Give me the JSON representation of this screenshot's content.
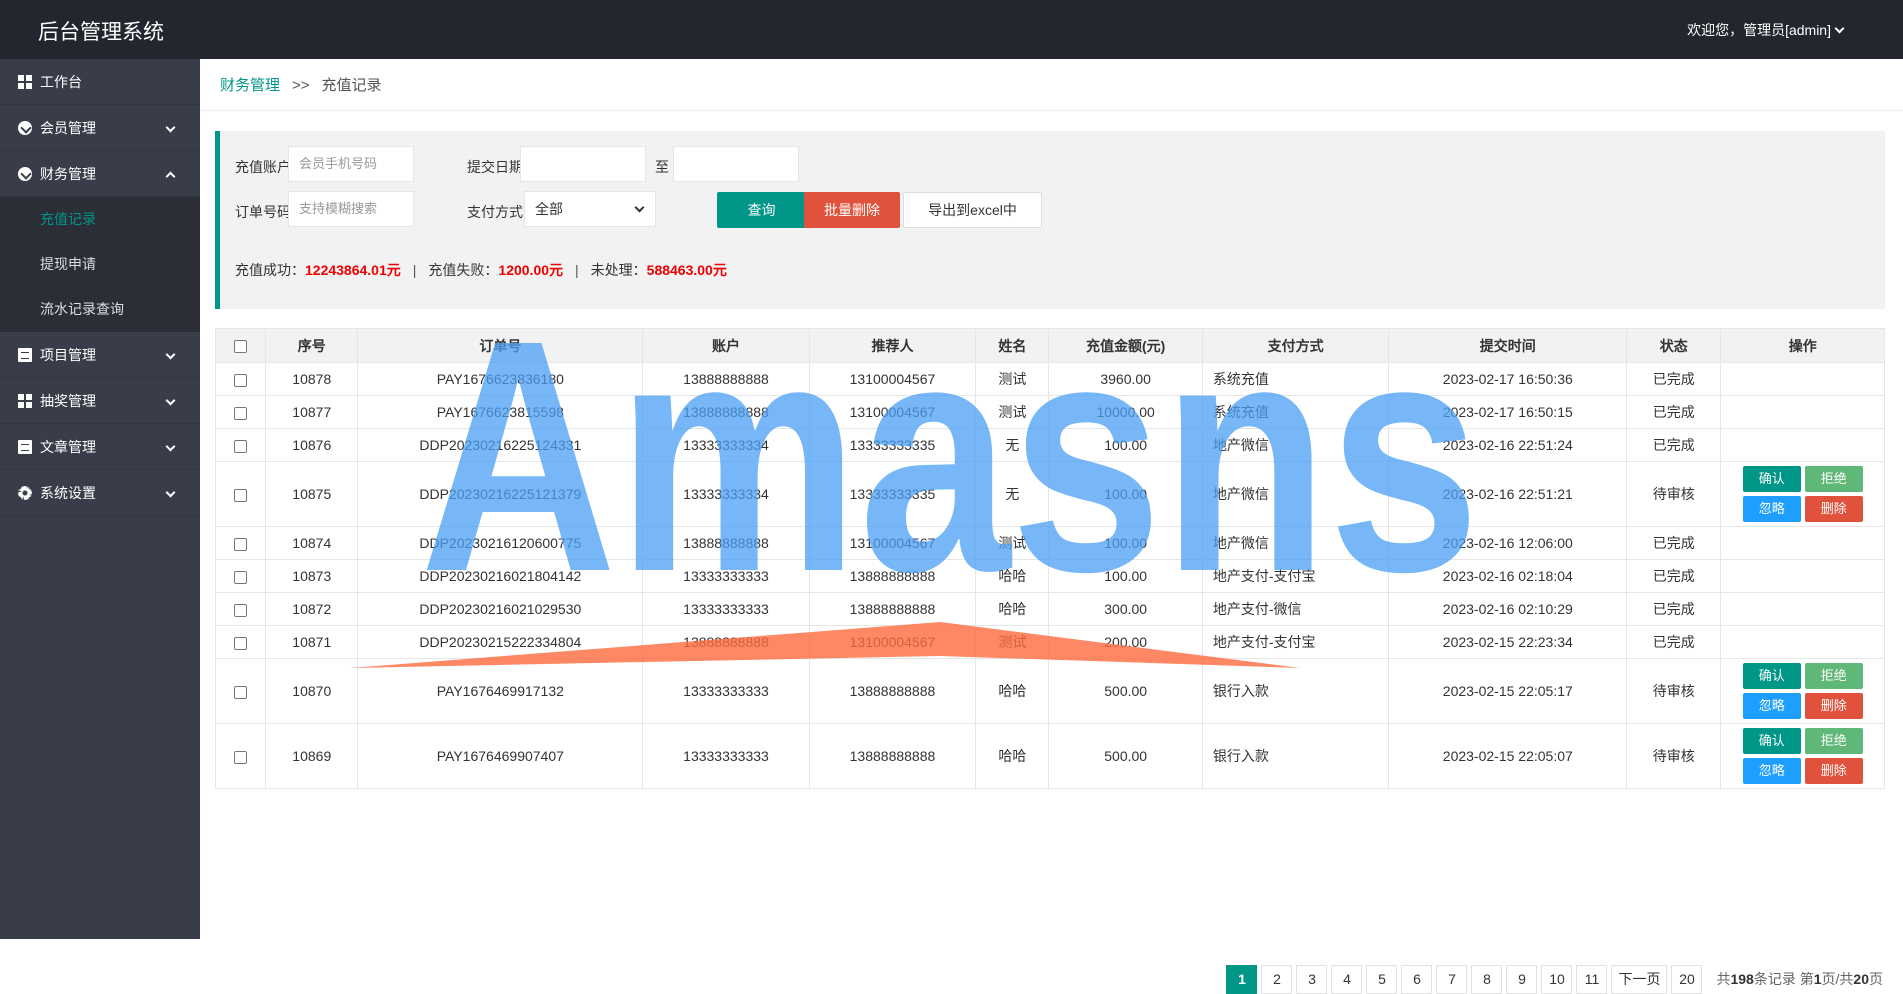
{
  "app": {
    "title": "后台管理系统",
    "user_greeting": "欢迎您，管理员[admin]"
  },
  "sidebar": {
    "items": [
      {
        "label": "工作台",
        "icon": "dashboard-icon"
      },
      {
        "label": "会员管理",
        "icon": "member-icon"
      },
      {
        "label": "财务管理",
        "icon": "finance-icon"
      },
      {
        "label": "项目管理",
        "icon": "project-icon"
      },
      {
        "label": "抽奖管理",
        "icon": "lottery-icon"
      },
      {
        "label": "文章管理",
        "icon": "article-icon"
      },
      {
        "label": "系统设置",
        "icon": "gear-icon"
      }
    ],
    "finance_sub": [
      "充值记录",
      "提现申请",
      "流水记录查询"
    ]
  },
  "breadcrumb": {
    "parent": "财务管理",
    "separator": ">>",
    "current": "充值记录"
  },
  "filter": {
    "account_label": "充值账户",
    "account_placeholder": "会员手机号码",
    "date_label": "提交日期",
    "date_to": "至",
    "order_label": "订单号码",
    "order_placeholder": "支持模糊搜索",
    "pay_label": "支付方式",
    "pay_selected": "全部",
    "query_button": "查询",
    "batch_delete_button": "批量删除",
    "export_button": "导出到excel中"
  },
  "stats": {
    "success_label": "充值成功：",
    "success_value": "12243864.01元",
    "fail_label": "充值失败：",
    "fail_value": "1200.00元",
    "pending_label": "未处理：",
    "pending_value": "588463.00元",
    "divider": "|"
  },
  "table": {
    "headers": [
      "序号",
      "订单号",
      "账户",
      "推荐人",
      "姓名",
      "充值金额(元)",
      "支付方式",
      "提交时间",
      "状态",
      "操作"
    ],
    "rows": [
      {
        "id": "10878",
        "order": "PAY1676623836180",
        "account": "13888888888",
        "referrer": "13100004567",
        "name": "测试",
        "amount": "3960.00",
        "method": "系统充值",
        "time": "2023-02-17 16:50:36",
        "status": "已完成"
      },
      {
        "id": "10877",
        "order": "PAY1676623815598",
        "account": "13888888888",
        "referrer": "13100004567",
        "name": "测试",
        "amount": "10000.00",
        "method": "系统充值",
        "time": "2023-02-17 16:50:15",
        "status": "已完成"
      },
      {
        "id": "10876",
        "order": "DDP20230216225124331",
        "account": "13333333334",
        "referrer": "13333333335",
        "name": "无",
        "amount": "100.00",
        "method": "地产微信",
        "time": "2023-02-16 22:51:24",
        "status": "已完成"
      },
      {
        "id": "10875",
        "order": "DDP20230216225121379",
        "account": "13333333334",
        "referrer": "13333333335",
        "name": "无",
        "amount": "100.00",
        "method": "地产微信",
        "time": "2023-02-16 22:51:21",
        "status": "待审核"
      },
      {
        "id": "10874",
        "order": "DDP20230216120600775",
        "account": "13888888888",
        "referrer": "13100004567",
        "name": "测试",
        "amount": "100.00",
        "method": "地产微信",
        "time": "2023-02-16 12:06:00",
        "status": "已完成"
      },
      {
        "id": "10873",
        "order": "DDP20230216021804142",
        "account": "13333333333",
        "referrer": "13888888888",
        "name": "哈哈",
        "amount": "100.00",
        "method": "地产支付-支付宝",
        "time": "2023-02-16 02:18:04",
        "status": "已完成"
      },
      {
        "id": "10872",
        "order": "DDP20230216021029530",
        "account": "13333333333",
        "referrer": "13888888888",
        "name": "哈哈",
        "amount": "300.00",
        "method": "地产支付-微信",
        "time": "2023-02-16 02:10:29",
        "status": "已完成"
      },
      {
        "id": "10871",
        "order": "DDP20230215222334804",
        "account": "13888888888",
        "referrer": "13100004567",
        "name": "测试",
        "amount": "200.00",
        "method": "地产支付-支付宝",
        "time": "2023-02-15 22:23:34",
        "status": "已完成"
      },
      {
        "id": "10870",
        "order": "PAY1676469917132",
        "account": "13333333333",
        "referrer": "13888888888",
        "name": "哈哈",
        "amount": "500.00",
        "method": "银行入款",
        "time": "2023-02-15 22:05:17",
        "status": "待审核"
      },
      {
        "id": "10869",
        "order": "PAY1676469907407",
        "account": "13333333333",
        "referrer": "13888888888",
        "name": "哈哈",
        "amount": "500.00",
        "method": "银行入款",
        "time": "2023-02-15 22:05:07",
        "status": "待审核"
      }
    ],
    "actions": {
      "confirm": "确认",
      "reject": "拒绝",
      "ignore": "忽略",
      "delete": "删除"
    }
  },
  "pagination": {
    "pages": [
      "1",
      "2",
      "3",
      "4",
      "5",
      "6",
      "7",
      "8",
      "9",
      "10",
      "11"
    ],
    "current": "1",
    "next": "下一页",
    "last": "20",
    "info_prefix": "共",
    "total_records": "198",
    "info_records": "条记录 第",
    "page_current": "1",
    "info_page": "页/共",
    "page_total": "20",
    "info_suffix": "页"
  },
  "watermark": {
    "text": "Amasns"
  },
  "colors": {
    "accent": "#009688",
    "danger": "#e0523c",
    "sidebar": "#393d49",
    "topbar": "#23262e"
  }
}
